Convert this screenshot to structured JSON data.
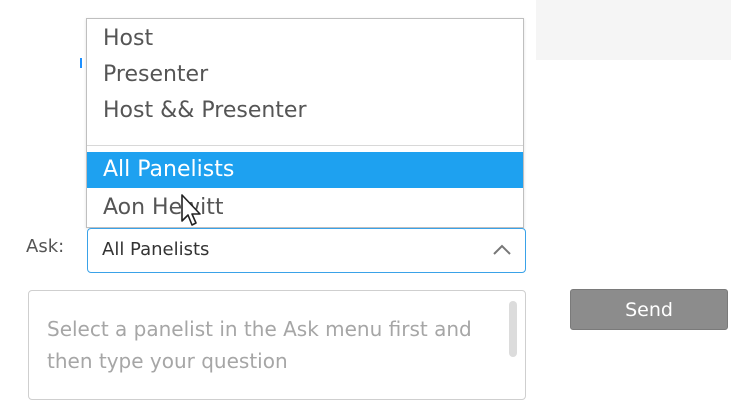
{
  "dropdown": {
    "options": [
      {
        "label": "Host"
      },
      {
        "label": "Presenter"
      },
      {
        "label": "Host && Presenter"
      },
      {
        "label": "All Panelists"
      },
      {
        "label": "Aon Hewitt"
      }
    ],
    "selected_label": "All Panelists"
  },
  "ask": {
    "label": "Ask:",
    "value": "All Panelists",
    "chevron_icon": "chevron-up-icon"
  },
  "question": {
    "placeholder": "Select a panelist in the Ask menu first and then type your question"
  },
  "send": {
    "label": "Send"
  },
  "colors": {
    "selection": "#1ea1f0",
    "accent_border": "#3aa2e8",
    "send_button": "#8c8c8c"
  }
}
